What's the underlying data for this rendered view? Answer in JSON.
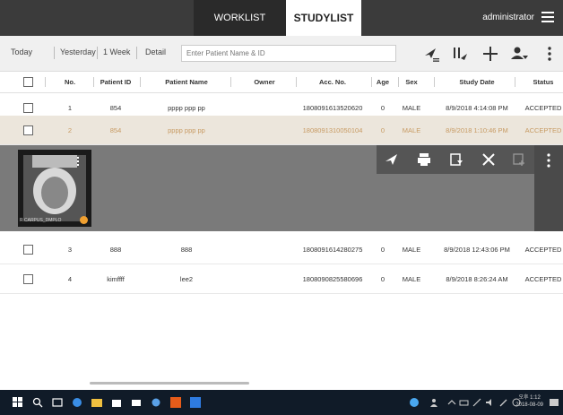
{
  "header": {
    "tabs": [
      {
        "label": "WORKLIST",
        "active": false
      },
      {
        "label": "STUDYLIST",
        "active": true
      }
    ],
    "user": "administrator"
  },
  "filter": {
    "buttons": [
      "Today",
      "Yesterday",
      "1 Week",
      "Detail"
    ],
    "search_placeholder": "Enter Patient Name & ID"
  },
  "columns": [
    "No.",
    "Patient ID",
    "Patient Name",
    "Owner",
    "Acc. No.",
    "Age",
    "Sex",
    "Study Date",
    "Status"
  ],
  "rows": [
    {
      "no": "1",
      "patient_id": "854",
      "patient_name": "pppp ppp pp",
      "owner": "",
      "acc_no": "1808091613520620",
      "age": "0",
      "sex": "MALE",
      "study_date": "8/9/2018 4:14:08 PM",
      "status": "ACCEPTED"
    },
    {
      "no": "2",
      "patient_id": "854",
      "patient_name": "pppp ppp pp",
      "owner": "",
      "acc_no": "1808091310050104",
      "age": "0",
      "sex": "MALE",
      "study_date": "8/9/2018 1:10:46 PM",
      "status": "ACCEPTED"
    },
    {
      "no": "3",
      "patient_id": "888",
      "patient_name": "888",
      "owner": "",
      "acc_no": "1808091614280275",
      "age": "0",
      "sex": "MALE",
      "study_date": "8/9/2018 12:43:06 PM",
      "status": "ACCEPTED"
    },
    {
      "no": "4",
      "patient_id": "kimffff",
      "patient_name": "lee2",
      "owner": "",
      "acc_no": "1808090825580696",
      "age": "0",
      "sex": "MALE",
      "study_date": "8/9/2018 8:26:24 AM",
      "status": "ACCEPTED"
    }
  ],
  "expanded": {
    "thumbnail_label": "R CARPUS_DMPLO"
  },
  "taskbar": {
    "time": "오후 1:12",
    "date": "2018-08-09"
  },
  "colors": {
    "accent": "#c79a62",
    "selected_row": "#ece6dc",
    "topbar": "#3b3b3b"
  }
}
